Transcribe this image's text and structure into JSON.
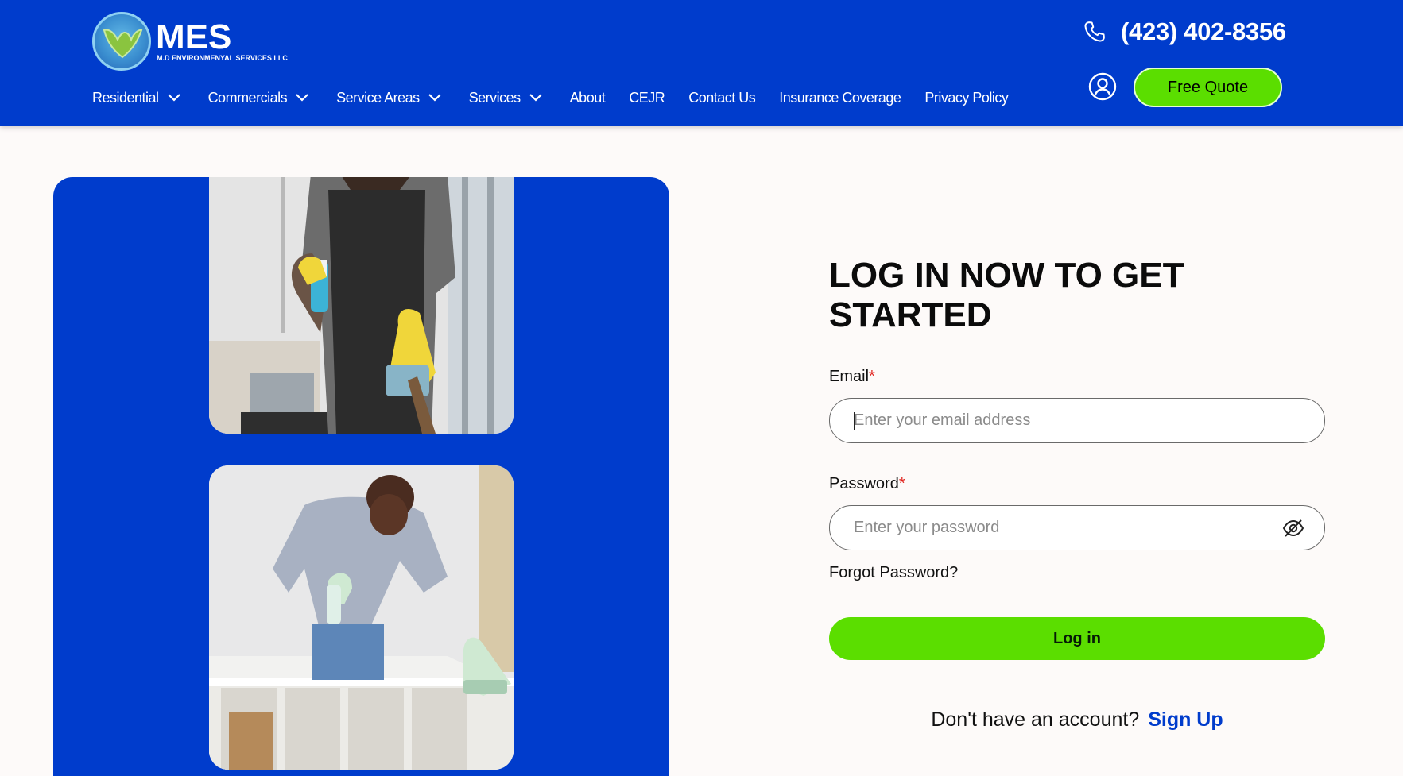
{
  "brand": {
    "name": "MES",
    "subtitle": "M.D ENVIRONMENYAL SERVICES LLC"
  },
  "nav": {
    "items": [
      {
        "label": "Residential",
        "dropdown": true
      },
      {
        "label": "Commercials",
        "dropdown": true
      },
      {
        "label": "Service Areas",
        "dropdown": true
      },
      {
        "label": "Services",
        "dropdown": true
      },
      {
        "label": "About",
        "dropdown": false
      },
      {
        "label": "CEJR",
        "dropdown": false
      },
      {
        "label": "Contact Us",
        "dropdown": false
      },
      {
        "label": "Insurance Coverage",
        "dropdown": false
      },
      {
        "label": "Privacy Policy",
        "dropdown": false
      }
    ]
  },
  "header": {
    "phone": "(423) 402-8356",
    "quote_button": "Free Quote",
    "account_icon": "user-circle-icon"
  },
  "login": {
    "title": "LOG IN NOW TO GET STARTED",
    "email_label": "Email",
    "email_placeholder": "Enter your email address",
    "email_value": "",
    "password_label": "Password",
    "password_placeholder": "Enter your password",
    "password_value": "",
    "required_mark": "*",
    "forgot_link": "Forgot Password?",
    "submit_label": "Log in",
    "signup_prompt": "Don't have an account?",
    "signup_link": "Sign Up"
  },
  "colors": {
    "brand_blue": "#003ccc",
    "accent_green": "#5bde00",
    "required_red": "#e0211c",
    "page_bg": "#fdfaf9"
  }
}
